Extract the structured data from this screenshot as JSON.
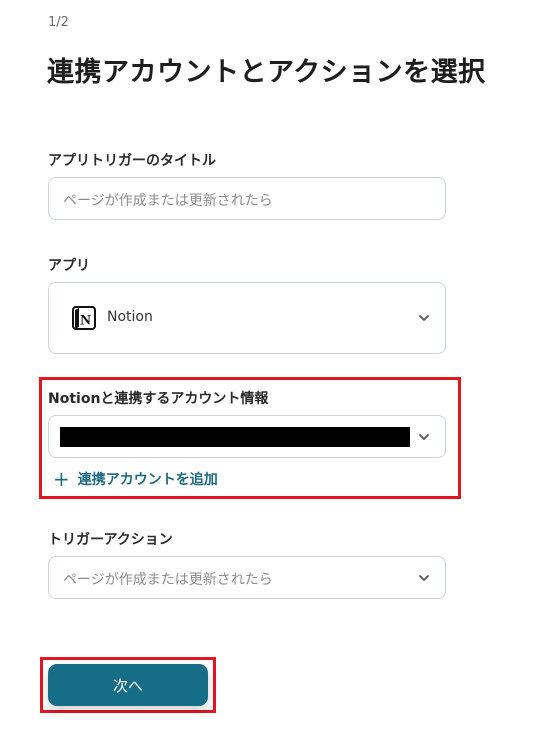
{
  "header": {
    "step": "1/2",
    "title": "連携アカウントとアクションを選択"
  },
  "trigger_title": {
    "label": "アプリトリガーのタイトル",
    "value": "ページが作成または更新されたら"
  },
  "app": {
    "label": "アプリ",
    "selected": "Notion",
    "icon": "notion-logo"
  },
  "account": {
    "label": "Notionと連携するアカウント情報",
    "add_link": "連携アカウントを追加",
    "add_icon": "plus-icon"
  },
  "trigger_action": {
    "label": "トリガーアクション",
    "selected": "ページが作成または更新されたら"
  },
  "buttons": {
    "next": "次へ"
  },
  "colors": {
    "primary": "#156e86",
    "link": "#1d6a82",
    "highlight": "#e3151f"
  }
}
